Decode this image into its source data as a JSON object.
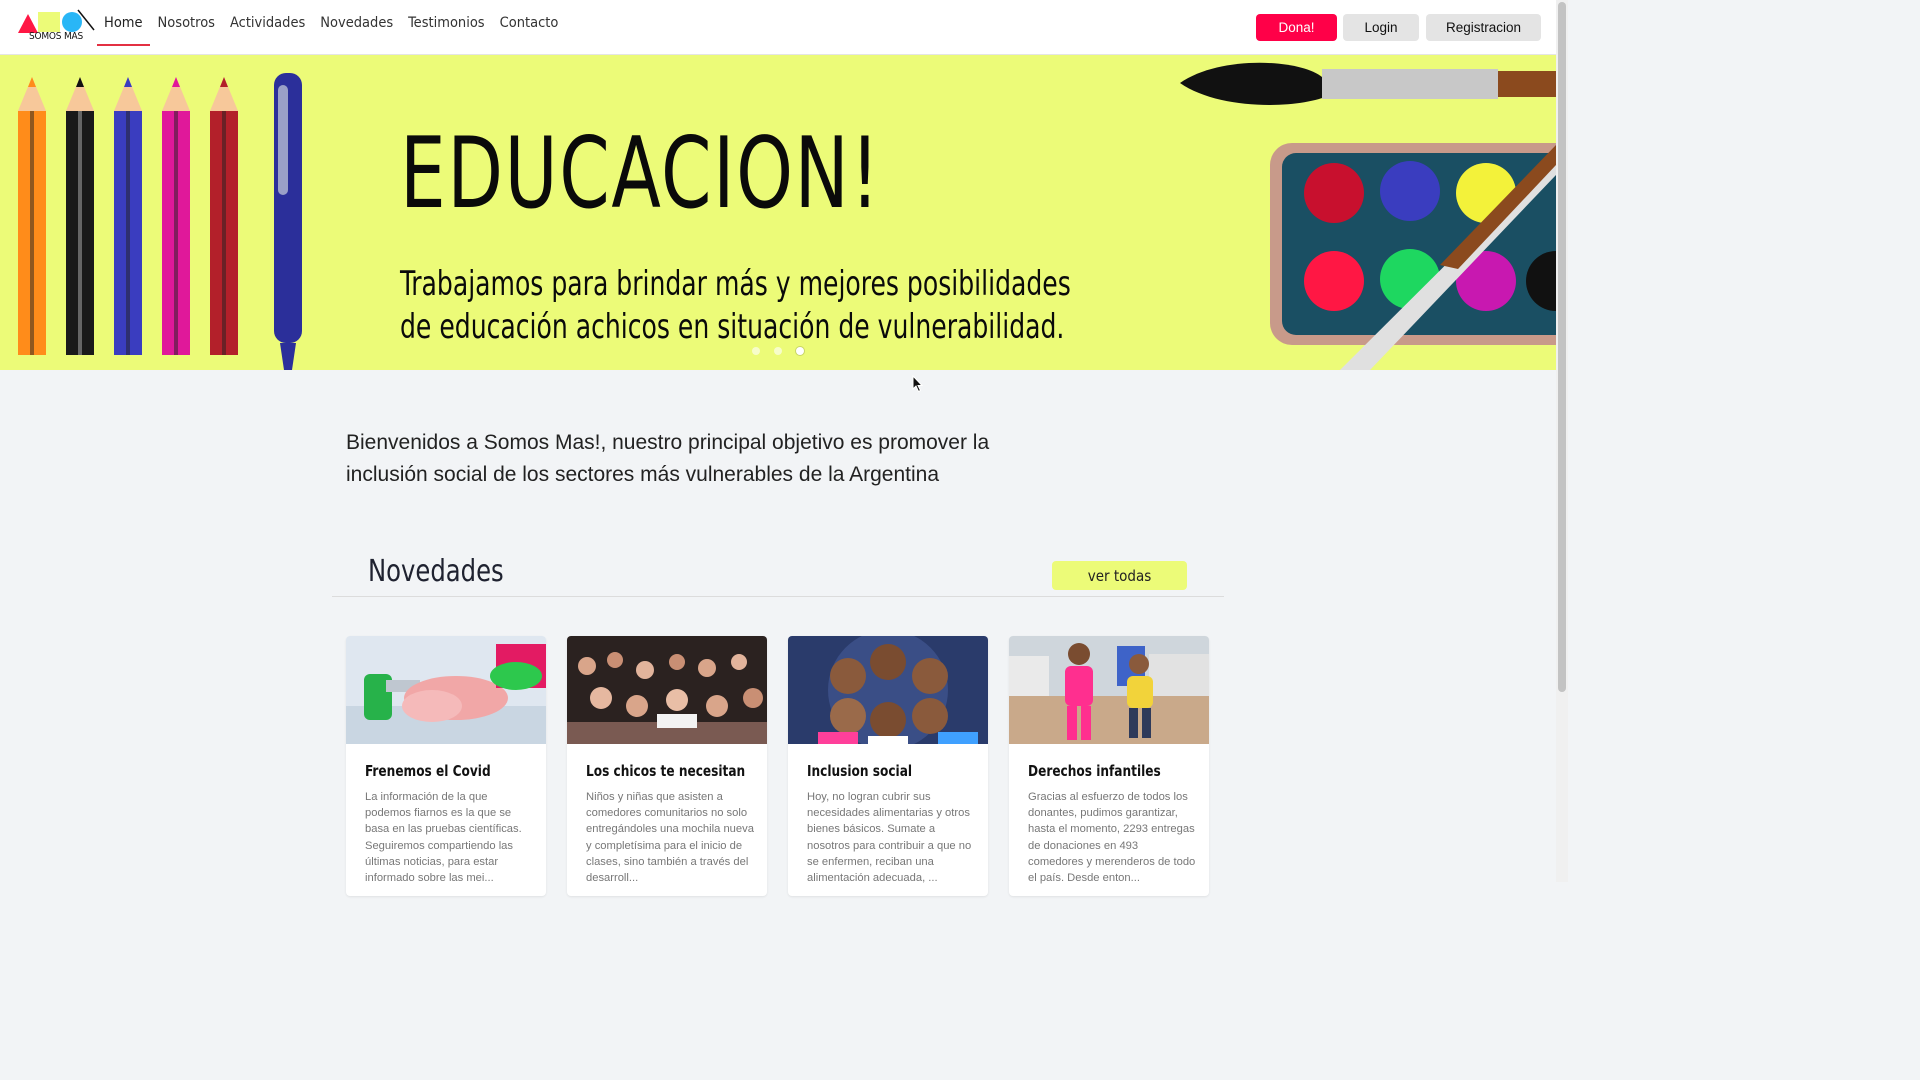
{
  "brand": {
    "logo_text": "SOMOS MAS"
  },
  "nav": {
    "items": [
      {
        "label": "Home",
        "active": true
      },
      {
        "label": "Nosotros",
        "active": false
      },
      {
        "label": "Actividades",
        "active": false
      },
      {
        "label": "Novedades",
        "active": false
      },
      {
        "label": "Testimonios",
        "active": false
      },
      {
        "label": "Contacto",
        "active": false
      }
    ],
    "dona_label": "Dona!",
    "login_label": "Login",
    "register_label": "Registracion"
  },
  "hero": {
    "title": "EDUCACION!",
    "subtitle_line1": "Trabajamos para brindar más y mejores posibilidades",
    "subtitle_line2": "de educación achicos en situación de vulnerabilidad.",
    "slides": 3,
    "active_slide": 3
  },
  "welcome": {
    "text": "Bienvenidos a Somos Mas!, nuestro principal objetivo es promover la inclusión social de los sectores más vulnerables de la Argentina"
  },
  "novedades": {
    "title": "Novedades",
    "ver_todas_label": "ver todas",
    "cards": [
      {
        "title": "Frenemos el Covid",
        "text": "La información de la que podemos fiarnos es la que se basa en las pruebas científicas. Seguiremos compartiendo las últimas noticias, para estar informado sobre las mei..."
      },
      {
        "title": "Los chicos te necesitan",
        "text": "Niños y niñas que asisten a comedores comunitarios no solo entregándoles una mochila nueva y completísima para el inicio de clases, sino también a través del desarroll..."
      },
      {
        "title": "Inclusion social",
        "text": "Hoy, no logran cubrir sus necesidades alimentarias y otros bienes básicos. Sumate a nosotros para contribuir a que no se enfermen, reciban una alimentación adecuada, ..."
      },
      {
        "title": "Derechos infantiles",
        "text": "Gracias al esfuerzo de todos los donantes, pudimos garantizar, hasta el momento, 2293 entregas de donaciones en 493 comedores y merenderos de todo el país. Desde enton..."
      }
    ]
  },
  "colors": {
    "accent": "#ff0048",
    "hero_bg": "#ecfb78",
    "nav_underline": "#e33042",
    "page_bg": "#f2f4f6"
  }
}
